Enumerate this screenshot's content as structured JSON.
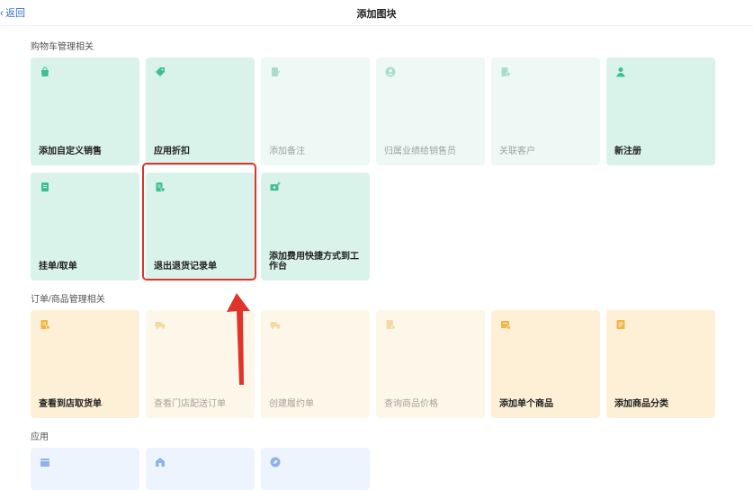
{
  "header": {
    "back_label": "返回",
    "title": "添加图块"
  },
  "sections": [
    {
      "title": "购物车管理相关",
      "tiles": [
        {
          "label": "添加自定义销售",
          "icon": "shopping-bag-icon",
          "enabled": true
        },
        {
          "label": "应用折扣",
          "icon": "tag-icon",
          "enabled": true
        },
        {
          "label": "添加备注",
          "icon": "note-edit-icon",
          "enabled": false
        },
        {
          "label": "归属业绩给销售员",
          "icon": "user-circle-icon",
          "enabled": false
        },
        {
          "label": "关联客户",
          "icon": "document-user-icon",
          "enabled": false
        },
        {
          "label": "新注册",
          "icon": "person-icon",
          "enabled": true
        },
        {
          "label": "挂单/取单",
          "icon": "document-icon",
          "enabled": true
        },
        {
          "label": "退出退货记录单",
          "icon": "return-record-icon",
          "enabled": true
        },
        {
          "label": "添加费用快捷方式到工作台",
          "icon": "add-fee-icon",
          "enabled": true
        }
      ]
    },
    {
      "title": "订单/商品管理相关",
      "tiles": [
        {
          "label": "查看到店取货单",
          "icon": "pickup-doc-icon",
          "enabled": true
        },
        {
          "label": "查看门店配送订单",
          "icon": "truck-icon",
          "enabled": false
        },
        {
          "label": "创建履约单",
          "icon": "truck-icon",
          "enabled": false
        },
        {
          "label": "查询商品价格",
          "icon": "price-tag-icon",
          "enabled": false
        },
        {
          "label": "添加单个商品",
          "icon": "add-product-icon",
          "enabled": true
        },
        {
          "label": "添加商品分类",
          "icon": "category-icon",
          "enabled": true
        }
      ]
    },
    {
      "title": "应用",
      "tiles": [
        {
          "label": "",
          "icon": "calendar-icon",
          "enabled": true
        },
        {
          "label": "",
          "icon": "store-icon",
          "enabled": true
        },
        {
          "label": "",
          "icon": "compass-icon",
          "enabled": true
        }
      ]
    }
  ],
  "colors": {
    "green_icon": "#3fbf8f",
    "green_icon_dim": "#a9ddc9",
    "orange_icon": "#f2b544",
    "orange_icon_dim": "#f3d9a3",
    "blue_icon": "#8fb2ec",
    "highlight": "#e0332b",
    "link": "#2f6fd6"
  }
}
